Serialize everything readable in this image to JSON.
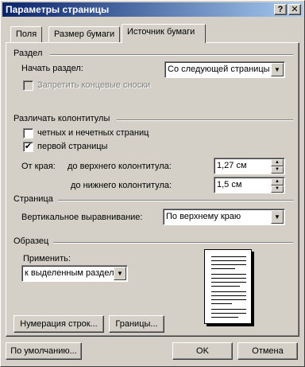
{
  "window": {
    "title": "Параметры страницы",
    "help_button": "?",
    "close_button": "✕"
  },
  "tabs": [
    {
      "label": "Поля",
      "active": false
    },
    {
      "label": "Размер бумаги",
      "active": false
    },
    {
      "label": "Источник бумаги",
      "active": true
    }
  ],
  "section_start": {
    "heading": "Раздел",
    "start_label": "Начать раздел:",
    "start_value": "Со следующей страницы",
    "suppress_endnotes_label": "Запретить концевые сноски",
    "suppress_endnotes_checked": false,
    "suppress_endnotes_disabled": true
  },
  "headers_footers": {
    "heading": "Различать колонтитулы",
    "odd_even_label": "четных и нечетных страниц",
    "odd_even_checked": false,
    "first_page_label": "первой страницы",
    "first_page_checked": true,
    "from_edge_label": "От края:",
    "header_label": "до верхнего колонтитула:",
    "header_value": "1,27 см",
    "footer_label": "до нижнего колонтитула:",
    "footer_value": "1,5 см"
  },
  "page": {
    "heading": "Страница",
    "valign_label": "Вертикальное выравнивание:",
    "valign_value": "По верхнему краю"
  },
  "preview": {
    "heading": "Образец",
    "apply_label": "Применить:",
    "apply_value": "к выделенным раздел"
  },
  "buttons": {
    "line_numbers": "Нумерация строк...",
    "borders": "Границы...",
    "default": "По умолчанию...",
    "ok": "OK",
    "cancel": "Отмена"
  },
  "icons": {
    "checkbox_check": "✔",
    "dropdown_arrow": "▼",
    "spin_up": "▲",
    "spin_down": "▼"
  }
}
